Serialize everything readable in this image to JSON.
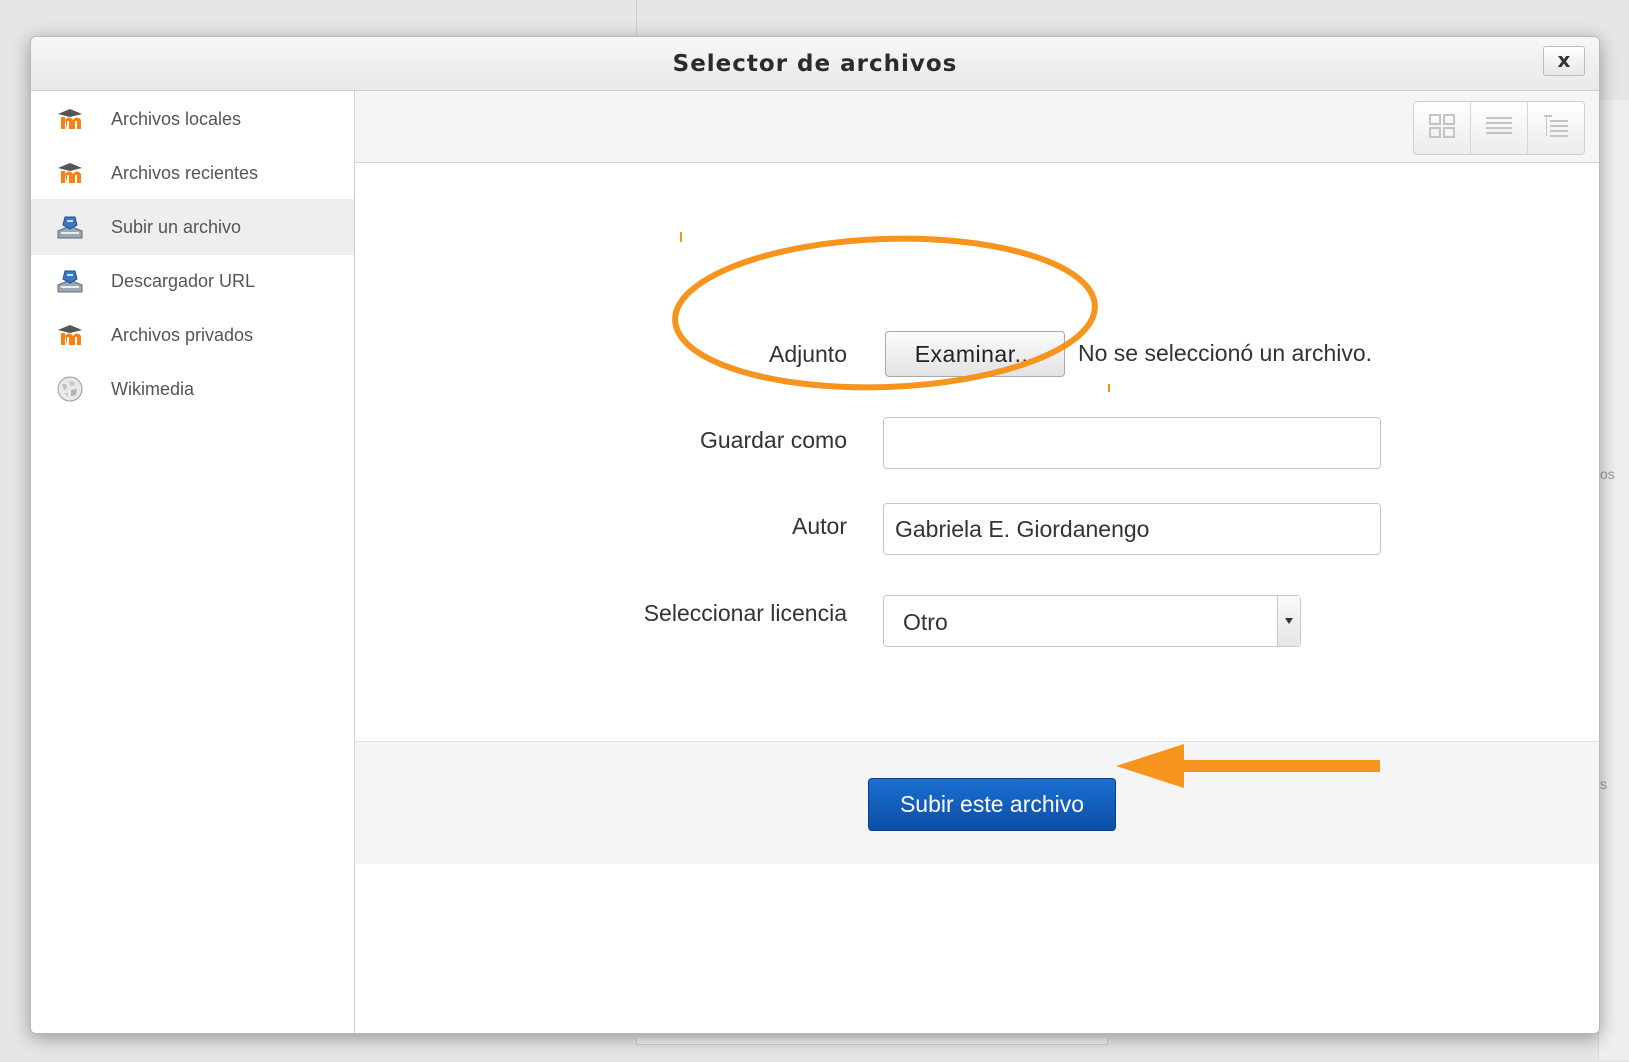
{
  "dialog": {
    "title": "Selector de archivos",
    "close_label": "x"
  },
  "sidebar": {
    "items": [
      {
        "label": "Archivos locales",
        "icon": "moodle-icon"
      },
      {
        "label": "Archivos recientes",
        "icon": "moodle-icon"
      },
      {
        "label": "Subir un archivo",
        "icon": "upload-icon",
        "active": true
      },
      {
        "label": "Descargador URL",
        "icon": "upload-icon"
      },
      {
        "label": "Archivos privados",
        "icon": "moodle-icon"
      },
      {
        "label": "Wikimedia",
        "icon": "wikipedia-globe-icon"
      }
    ]
  },
  "toolbar": {
    "views": [
      "icons-view",
      "list-view",
      "tree-view"
    ]
  },
  "form": {
    "attachment_label": "Adjunto",
    "browse_button": "Examinar...",
    "file_status": "No se seleccionó un archivo.",
    "save_as_label": "Guardar como",
    "save_as_value": "",
    "author_label": "Autor",
    "author_value": "Gabriela E. Giordanengo",
    "license_label": "Seleccionar licencia",
    "license_value": "Otro",
    "submit_button": "Subir este archivo"
  },
  "background": {
    "right_text_1": "os",
    "right_text_2": "s"
  },
  "colors": {
    "annotation": "#f7941d",
    "primary_button": "#0b4ea6",
    "moodle_orange": "#f98012"
  }
}
